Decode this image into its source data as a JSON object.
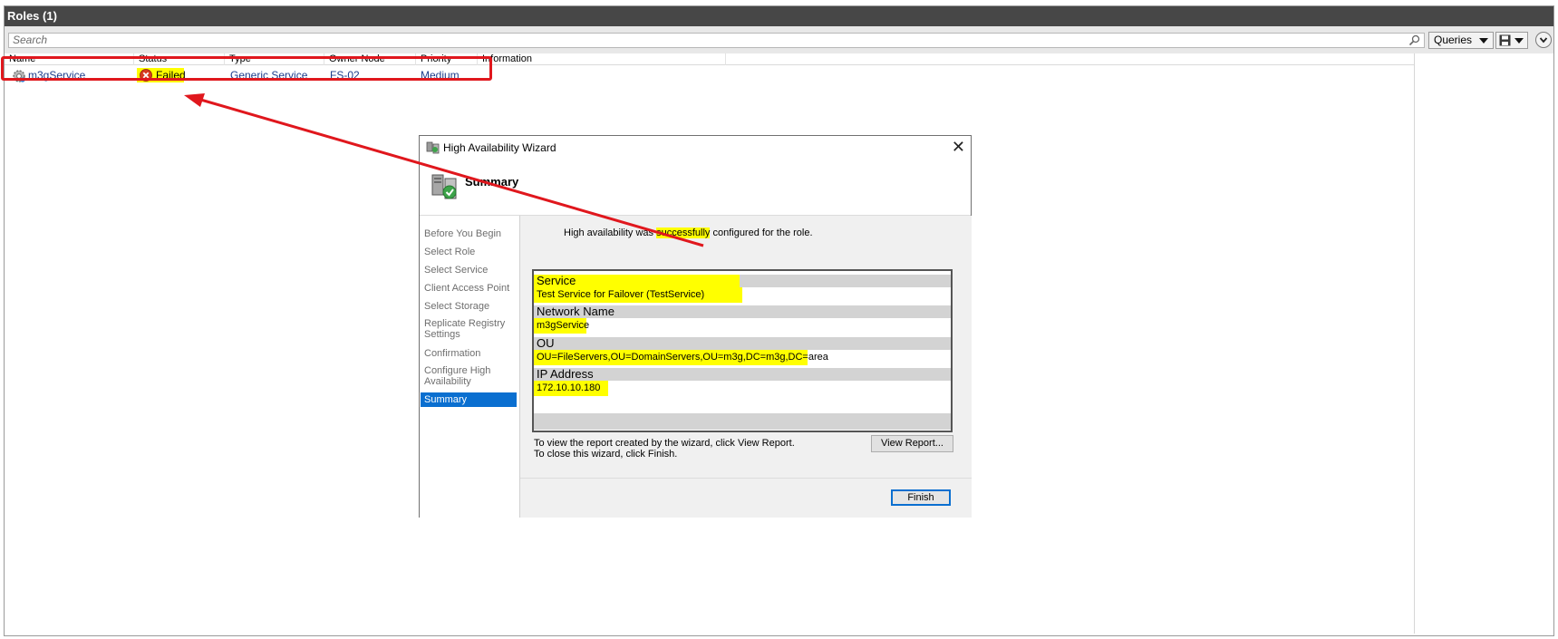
{
  "window": {
    "title": "Roles (1)"
  },
  "toolbar": {
    "search_placeholder": "Search",
    "queries_label": "Queries",
    "icons": [
      "search-icon",
      "save-icon",
      "chevron-down-icon"
    ]
  },
  "grid": {
    "columns": [
      "Name",
      "Status",
      "Type",
      "Owner Node",
      "Priority",
      "Information"
    ],
    "rows": [
      {
        "name": "m3gService",
        "status": "Failed",
        "type": "Generic Service",
        "owner_node": "FS-02",
        "priority": "Medium",
        "information": ""
      }
    ]
  },
  "wizard": {
    "title": "High Availability Wizard",
    "header": "Summary",
    "steps": [
      "Before You Begin",
      "Select Role",
      "Select Service",
      "Client Access Point",
      "Select Storage",
      "Replicate Registry Settings",
      "Confirmation",
      "Configure High Availability",
      "Summary"
    ],
    "active_step": "Summary",
    "message_pre": "High availability was ",
    "message_hl": "successfully",
    "message_post": " configured for the role.",
    "summary": [
      {
        "heading": "Service",
        "value": "Test Service for Failover (TestService)"
      },
      {
        "heading": "Network Name",
        "value": "m3gService"
      },
      {
        "heading": "OU",
        "value": "OU=FileServers,OU=DomainServers,OU=m3g,DC=m3g,DC=area"
      },
      {
        "heading": "IP Address",
        "value": "172.10.10.180"
      }
    ],
    "report_note_line1": "To view the report created by the wizard, click View Report.",
    "report_note_line2": "To close this wizard, click Finish.",
    "view_report_label": "View Report...",
    "finish_label": "Finish"
  },
  "colors": {
    "highlight": "#ffff00",
    "annotation_red": "#e0171d",
    "selection_blue": "#0a6fd0",
    "link_text": "#1c3d8c",
    "titlebar": "#474747"
  }
}
